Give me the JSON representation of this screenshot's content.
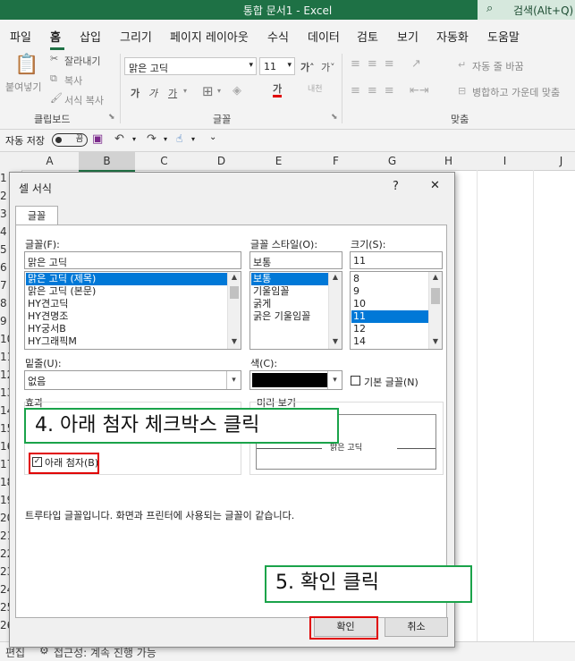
{
  "titlebar": {
    "title": "통합 문서1  -  Excel",
    "search": "검색(Alt+Q)"
  },
  "menu": [
    "파일",
    "홈",
    "삽입",
    "그리기",
    "페이지 레이아웃",
    "수식",
    "데이터",
    "검토",
    "보기",
    "자동화",
    "도움말"
  ],
  "ribbon": {
    "paste": "붙여넣기",
    "cut": "잘라내기",
    "copy": "복사",
    "format_painter": "서식 복사",
    "clipboard_label": "클립보드",
    "font_name": "맑은 고딕",
    "font_size": "11",
    "font_label": "글꼴",
    "wrap_text": "자동 줄 바꿈",
    "merge_center": "병합하고 가운데 맞춤",
    "align_label": "맞춤",
    "bold": "가",
    "italic": "가",
    "underline": "가",
    "font_color_glyph": "가",
    "grow_font": "가˄",
    "shrink_font": "가˅",
    "phonetic": "내천"
  },
  "qat": {
    "autosave": "자동 저장",
    "toggle": "끔"
  },
  "columns": [
    "A",
    "B",
    "C",
    "D",
    "E",
    "F",
    "G",
    "H",
    "I",
    "J"
  ],
  "rows": [
    "1",
    "2",
    "3",
    "4",
    "5",
    "6",
    "7",
    "8",
    "9",
    "10",
    "11",
    "12",
    "13",
    "14",
    "15",
    "16",
    "17",
    "18",
    "19",
    "20",
    "21",
    "22",
    "23",
    "24",
    "25",
    "26"
  ],
  "statusbar": {
    "mode": "편집",
    "accessibility": "접근성: 계속 진행 가능"
  },
  "dialog": {
    "title": "셀 서식",
    "help": "?",
    "close": "✕",
    "tab": "글꼴",
    "font_label": "글꼴(F):",
    "font_value": "맑은 고딕",
    "fonts": [
      "맑은 고딕 (제목)",
      "맑은 고딕 (본문)",
      "HY견고딕",
      "HY견명조",
      "HY궁서B",
      "HY그래픽M"
    ],
    "style_label": "글꼴 스타일(O):",
    "style_value": "보통",
    "styles": [
      "보통",
      "기울임꼴",
      "굵게",
      "굵은 기울임꼴"
    ],
    "size_label": "크기(S):",
    "size_value": "11",
    "sizes": [
      "8",
      "9",
      "10",
      "11",
      "12",
      "14"
    ],
    "underline_label": "밑줄(U):",
    "underline_value": "없음",
    "color_label": "색(C):",
    "normal_font": "기본 글꼴(N)",
    "effects_label": "효과",
    "subscript": "아래 첨자(B)",
    "preview_label": "미리 보기",
    "preview_text": "맑은 고딕",
    "info": "트루타입 글꼴입니다. 화면과 프린터에 사용되는 글꼴이 같습니다.",
    "ok": "확인",
    "cancel": "취소"
  },
  "annotations": {
    "step4": "4. 아래 첨자 체크박스 클릭",
    "step5": "5. 확인 클릭"
  },
  "colors": {
    "excel_green": "#1e7145",
    "annotation_green": "#1aa34a",
    "highlight_red": "#e00000",
    "selection_blue": "#0078d7"
  }
}
